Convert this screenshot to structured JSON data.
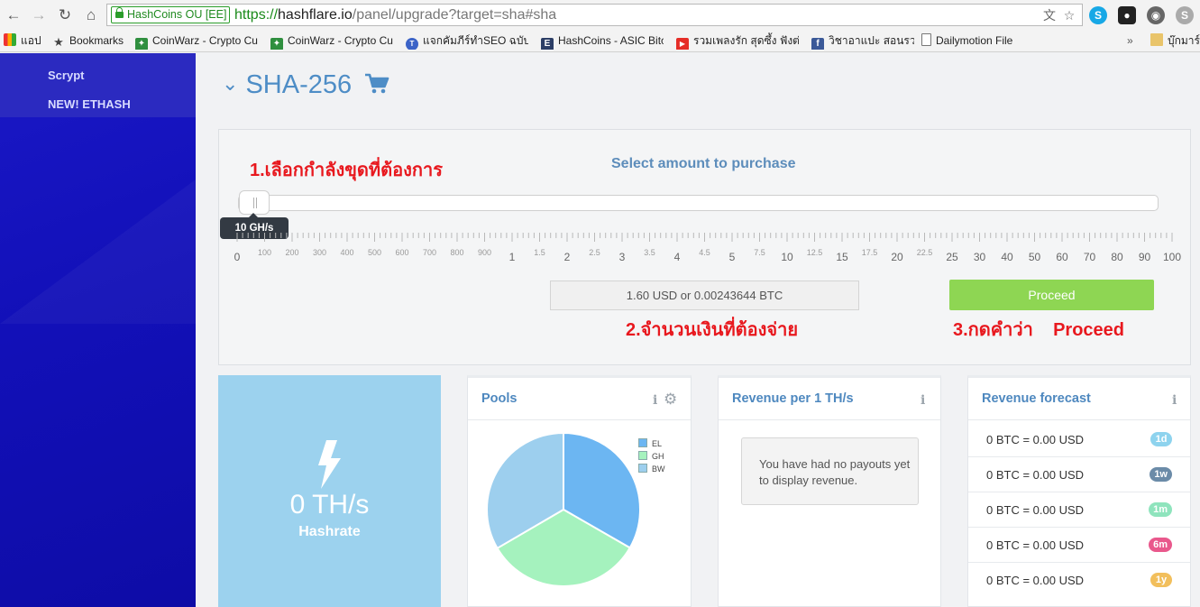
{
  "browser": {
    "secure_label": "HashCoins OU [EE]",
    "url_scheme": "https://",
    "url_host": "hashflare.io",
    "url_path": "/panel/upgrade?target=sha#sha",
    "bookmarks": [
      "แอป",
      "Bookmarks",
      "CoinWarz - Crypto Cu",
      "CoinWarz - Crypto Cu",
      "แจกคัมภีร์ทำSEO ฉบับเริ่",
      "HashCoins - ASIC Bitc",
      "รวมเพลงรัก สุดซึ้ง ฟังต่อเ",
      "วิชาอาแปะ สอนรวย",
      "Dailymotion File",
      "บุ๊กมาร์ก"
    ],
    "overflow_label": "»"
  },
  "sidebar": {
    "items": [
      {
        "label": "Scrypt"
      },
      {
        "label": "NEW! ETHASH"
      }
    ]
  },
  "page": {
    "title": "SHA-256"
  },
  "purchase": {
    "annotation_1": "1.เลือกกำลังขุดที่ต้องการ",
    "select_label": "Select amount to purchase",
    "slider_value": "10 GH/s",
    "slider_fraction": 0.0,
    "scale_labels": [
      "0",
      "100",
      "200",
      "300",
      "400",
      "500",
      "600",
      "700",
      "800",
      "900",
      "1",
      "1.5",
      "2",
      "2.5",
      "3",
      "3.5",
      "4",
      "4.5",
      "5",
      "7.5",
      "10",
      "12.5",
      "15",
      "17.5",
      "20",
      "22.5",
      "25",
      "30",
      "40",
      "50",
      "60",
      "70",
      "80",
      "90",
      "100"
    ],
    "price_text": "1.60 USD or 0.00243644 BTC",
    "annotation_2": "2.จำนวนเงินที่ต้องจ่าย",
    "proceed_label": "Proceed",
    "annotation_3": "3.กดคำว่า    Proceed"
  },
  "hashrate_card": {
    "value": "0 TH/s",
    "label": "Hashrate"
  },
  "pools_card": {
    "title": "Pools"
  },
  "chart_data": {
    "type": "pie",
    "categories": [
      "EL",
      "GH",
      "BW"
    ],
    "values": [
      33.3,
      33.3,
      33.4
    ],
    "colors": [
      "#6cb6f2",
      "#a5f2be",
      "#9dcfee"
    ],
    "legend": "top-right"
  },
  "revenue_card": {
    "title": "Revenue per 1 TH/s",
    "message": "You have had no payouts yet to display revenue."
  },
  "forecast_card": {
    "title": "Revenue forecast",
    "rows": [
      {
        "text": "0 BTC = 0.00 USD",
        "badge": "1d",
        "color": "#8ed3ee"
      },
      {
        "text": "0 BTC = 0.00 USD",
        "badge": "1w",
        "color": "#6b8ba8"
      },
      {
        "text": "0 BTC = 0.00 USD",
        "badge": "1m",
        "color": "#8fe4bd"
      },
      {
        "text": "0 BTC = 0.00 USD",
        "badge": "6m",
        "color": "#e9588c"
      },
      {
        "text": "0 BTC = 0.00 USD",
        "badge": "1y",
        "color": "#f2bf5c"
      }
    ]
  }
}
